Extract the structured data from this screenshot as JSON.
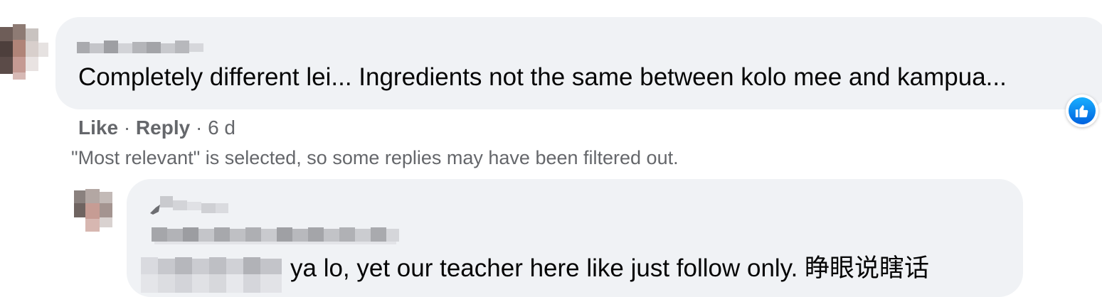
{
  "comment": {
    "text": "Completely different lei... Ingredients not the same between kolo mee and kampua...",
    "actions": {
      "like_label": "Like",
      "separator": "·",
      "reply_label": "Reply",
      "time": "6 d"
    },
    "reaction_icon": "thumbs-up-icon"
  },
  "filter_note": "\"Most relevant\" is selected, so some replies may have been filtered out.",
  "reply": {
    "text": "ya lo, yet our teacher here like just follow only. 睁眼说瞎话"
  },
  "colors": {
    "bubble_bg": "#f0f2f5",
    "secondary_text": "#65676b",
    "like_blue": "#0866ff"
  }
}
